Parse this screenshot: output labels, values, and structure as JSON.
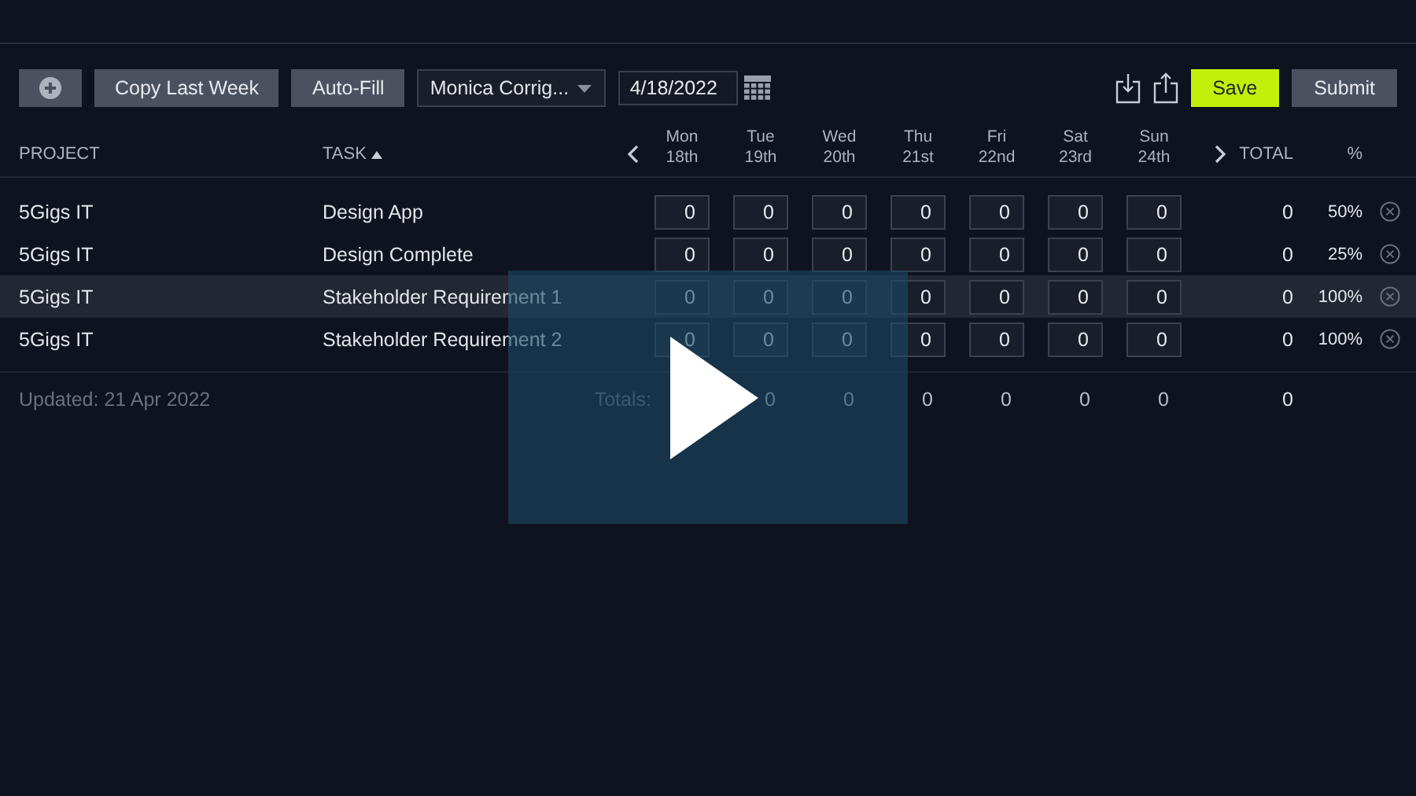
{
  "toolbar": {
    "copy_button": "Copy Last Week",
    "autofill_button": "Auto-Fill",
    "employee_select": "Monica Corrig...",
    "date_field": "4/18/2022",
    "save_button": "Save",
    "submit_button": "Submit"
  },
  "columns": {
    "project": "PROJECT",
    "task": "TASK",
    "task_sorted_ascending": true,
    "total": "TOTAL",
    "percent": "%"
  },
  "days": [
    {
      "day": "Mon",
      "date": "18th"
    },
    {
      "day": "Tue",
      "date": "19th"
    },
    {
      "day": "Wed",
      "date": "20th"
    },
    {
      "day": "Thu",
      "date": "21st"
    },
    {
      "day": "Fri",
      "date": "22nd"
    },
    {
      "day": "Sat",
      "date": "23rd"
    },
    {
      "day": "Sun",
      "date": "24th"
    }
  ],
  "rows": [
    {
      "project": "5Gigs IT",
      "task": "Design App",
      "hours": [
        "0",
        "0",
        "0",
        "0",
        "0",
        "0",
        "0"
      ],
      "total": "0",
      "percent": "50%",
      "selected": false
    },
    {
      "project": "5Gigs IT",
      "task": "Design Complete",
      "hours": [
        "0",
        "0",
        "0",
        "0",
        "0",
        "0",
        "0"
      ],
      "total": "0",
      "percent": "25%",
      "selected": false
    },
    {
      "project": "5Gigs IT",
      "task": "Stakeholder Requirement 1",
      "hours": [
        "0",
        "0",
        "0",
        "0",
        "0",
        "0",
        "0"
      ],
      "total": "0",
      "percent": "100%",
      "selected": true
    },
    {
      "project": "5Gigs IT",
      "task": "Stakeholder Requirement 2",
      "hours": [
        "0",
        "0",
        "0",
        "0",
        "0",
        "0",
        "0"
      ],
      "total": "0",
      "percent": "100%",
      "selected": false
    }
  ],
  "footer": {
    "updated": "Updated: 21 Apr 2022",
    "totals_label": "Totals:",
    "day_totals": [
      "0",
      "0",
      "0",
      "0",
      "0",
      "0"
    ],
    "grand_total": "0"
  },
  "video_overlay": {
    "shown": true
  }
}
